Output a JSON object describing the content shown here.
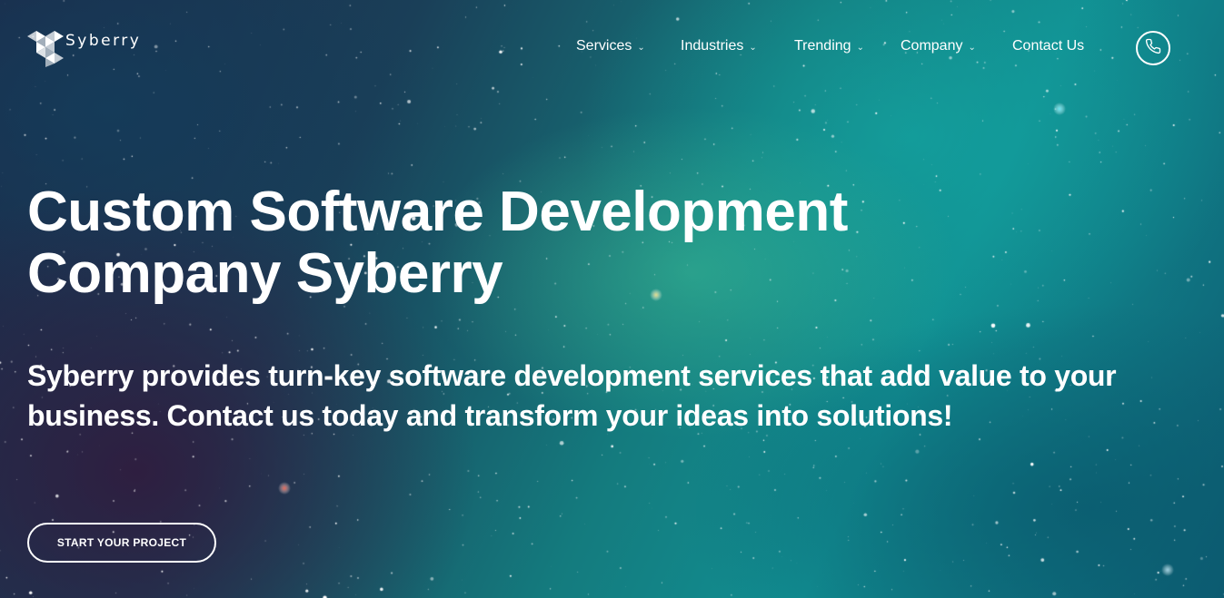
{
  "brand": {
    "name": "Syberry",
    "logo_icon": "triangle-cluster-logo-icon"
  },
  "nav": {
    "items": [
      {
        "label": "Services",
        "has_dropdown": true
      },
      {
        "label": "Industries",
        "has_dropdown": true
      },
      {
        "label": "Trending",
        "has_dropdown": true
      },
      {
        "label": "Company",
        "has_dropdown": true
      },
      {
        "label": "Contact Us",
        "has_dropdown": false
      }
    ],
    "dropdown_icon": "chevron-down-icon",
    "phone_icon": "phone-icon"
  },
  "hero": {
    "title": "Custom Software Development Company Syberry",
    "subtitle": "Syberry provides turn-key software development services that add value to your business. Contact us today and transform your ideas into solutions!",
    "cta_label": "START YOUR PROJECT"
  },
  "colors": {
    "text": "#ffffff",
    "background_teal": "#118f92",
    "background_dark": "#1c2b4a"
  }
}
